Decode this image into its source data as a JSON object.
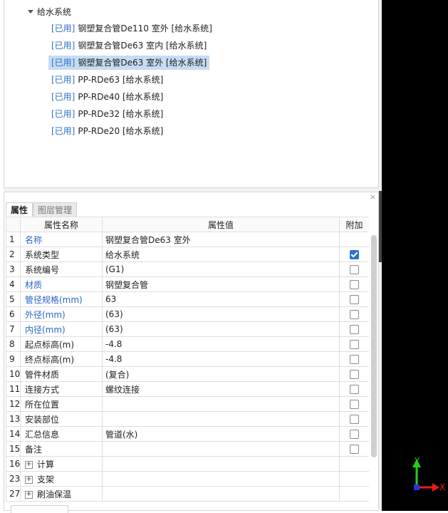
{
  "tree": {
    "root_label": "给水系统",
    "items": [
      {
        "tag": "[已用]",
        "label": "钢塑复合管De110 室外 [给水系统]",
        "selected": false
      },
      {
        "tag": "[已用]",
        "label": "钢塑复合管De63 室内 [给水系统]",
        "selected": false
      },
      {
        "tag": "[已用]",
        "label": "钢塑复合管De63 室外 [给水系统]",
        "selected": true
      },
      {
        "tag": "[已用]",
        "label": "PP-RDe63 [给水系统]",
        "selected": false
      },
      {
        "tag": "[已用]",
        "label": "PP-RDe40 [给水系统]",
        "selected": false
      },
      {
        "tag": "[已用]",
        "label": "PP-RDe32 [给水系统]",
        "selected": false
      },
      {
        "tag": "[已用]",
        "label": "PP-RDe20 [给水系统]",
        "selected": false
      }
    ]
  },
  "tabs": [
    {
      "label": "属性",
      "active": true
    },
    {
      "label": "图层管理",
      "active": false
    }
  ],
  "close_label": "×",
  "table": {
    "headers": [
      "属性名称",
      "属性值",
      "附加"
    ],
    "rows": [
      {
        "num": "1",
        "name": "名称",
        "value": "钢塑复合管De63 室外",
        "blue": true,
        "check": null,
        "expand": false
      },
      {
        "num": "2",
        "name": "系统类型",
        "value": "给水系统",
        "blue": false,
        "check": true,
        "expand": false
      },
      {
        "num": "3",
        "name": "系统编号",
        "value": "(G1)",
        "blue": false,
        "check": false,
        "expand": false
      },
      {
        "num": "4",
        "name": "材质",
        "value": "钢塑复合管",
        "blue": true,
        "check": false,
        "expand": false
      },
      {
        "num": "5",
        "name": "管径规格(mm)",
        "value": "63",
        "blue": true,
        "check": false,
        "expand": false
      },
      {
        "num": "6",
        "name": "外径(mm)",
        "value": "(63)",
        "blue": true,
        "check": false,
        "expand": false
      },
      {
        "num": "7",
        "name": "内径(mm)",
        "value": "(63)",
        "blue": true,
        "check": false,
        "expand": false
      },
      {
        "num": "8",
        "name": "起点标高(m)",
        "value": "-4.8",
        "blue": false,
        "check": false,
        "expand": false
      },
      {
        "num": "9",
        "name": "终点标高(m)",
        "value": "-4.8",
        "blue": false,
        "check": false,
        "expand": false
      },
      {
        "num": "10",
        "name": "管件材质",
        "value": "(复合)",
        "blue": false,
        "check": false,
        "expand": false
      },
      {
        "num": "11",
        "name": "连接方式",
        "value": "螺纹连接",
        "blue": false,
        "check": false,
        "expand": false
      },
      {
        "num": "12",
        "name": "所在位置",
        "value": "",
        "blue": false,
        "check": false,
        "expand": false
      },
      {
        "num": "13",
        "name": "安装部位",
        "value": "",
        "blue": false,
        "check": false,
        "expand": false
      },
      {
        "num": "14",
        "name": "汇总信息",
        "value": "管道(水)",
        "blue": false,
        "check": false,
        "expand": false
      },
      {
        "num": "15",
        "name": "备注",
        "value": "",
        "blue": false,
        "check": false,
        "expand": false
      },
      {
        "num": "16",
        "name": "计算",
        "value": "",
        "blue": false,
        "check": null,
        "expand": true
      },
      {
        "num": "23",
        "name": "支架",
        "value": "",
        "blue": false,
        "check": null,
        "expand": true
      },
      {
        "num": "27",
        "name": "刷油保温",
        "value": "",
        "blue": false,
        "check": null,
        "expand": true
      }
    ]
  },
  "axis": {
    "y_label": "Y",
    "x_label": "X",
    "y_color": "#1fcf1f",
    "x_color": "#e81c1c",
    "origin_color": "#2233dd"
  }
}
